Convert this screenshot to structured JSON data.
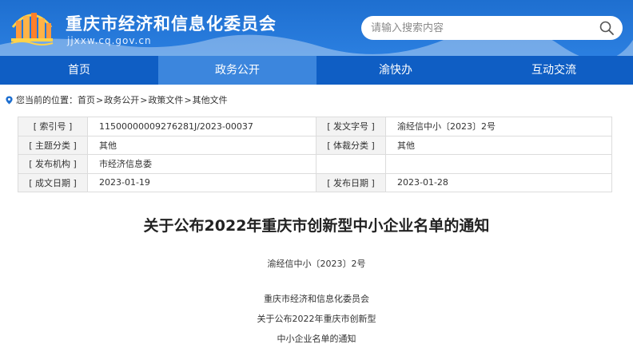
{
  "header": {
    "site_title": "重庆市经济和信息化委员会",
    "site_url": "jjxxw.cq.gov.cn",
    "logo_icon": "city-skyline-logo-icon",
    "colors": {
      "header_blue": "#1e6fd0",
      "nav_blue": "#0f5ec4",
      "nav_active": "#3c86dd"
    }
  },
  "search": {
    "placeholder": "请输入搜索内容",
    "icon": "search-icon"
  },
  "nav": {
    "items": [
      "首页",
      "政务公开",
      "渝快办",
      "互动交流"
    ],
    "active_index": 1
  },
  "breadcrumb": {
    "prefix": "您当前的位置：",
    "items": [
      "首页",
      "政务公开",
      "政策文件",
      "其他文件"
    ],
    "separator": ">"
  },
  "meta": {
    "rows": [
      {
        "k1": "[ 索引号 ]",
        "v1": "11500000009276281J/2023-00037",
        "k2": "[ 发文字号 ]",
        "v2": "渝经信中小〔2023〕2号"
      },
      {
        "k1": "[ 主题分类 ]",
        "v1": "其他",
        "k2": "[ 体裁分类 ]",
        "v2": "其他"
      },
      {
        "k1": "[ 发布机构 ]",
        "v1": "市经济信息委",
        "k2": "",
        "v2": ""
      },
      {
        "k1": "[ 成文日期 ]",
        "v1": "2023-01-19",
        "k2": "[ 发布日期 ]",
        "v2": "2023-01-28"
      }
    ]
  },
  "article": {
    "title": "关于公布2022年重庆市创新型中小企业名单的通知",
    "doc_number": "渝经信中小〔2023〕2号",
    "lines": [
      "重庆市经济和信息化委员会",
      "关于公布2022年重庆市创新型",
      "中小企业名单的通知"
    ]
  }
}
